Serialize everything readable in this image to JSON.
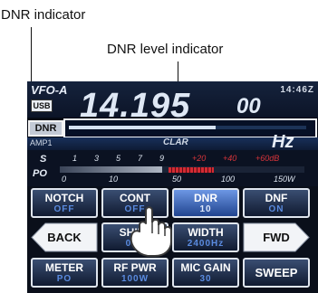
{
  "callouts": {
    "dnr_indicator": "DNR indicator",
    "dnr_level_indicator": "DNR level indicator"
  },
  "display": {
    "vfo": "VFO-A",
    "mode": "USB",
    "frequency_main": "14.195",
    "frequency_fraction": "00",
    "clock": "14:46Z",
    "dnr_badge": "DNR",
    "dnr_level": 0.62,
    "amp": "AMP1",
    "clar": "CLAR",
    "unit": "Hz"
  },
  "meter": {
    "s_label": "S",
    "po_label": "PO",
    "s_ticks": [
      "1",
      "3",
      "5",
      "7",
      "9",
      "+20",
      "+40",
      "+60dB"
    ],
    "po_ticks": [
      "0",
      "10",
      "50",
      "100",
      "150W"
    ],
    "level": 0.42
  },
  "buttons": {
    "notch": {
      "label": "NOTCH",
      "value": "OFF"
    },
    "cont": {
      "label": "CONT",
      "value": "OFF"
    },
    "dnr": {
      "label": "DNR",
      "value": "10"
    },
    "dnf": {
      "label": "DNF",
      "value": "ON"
    },
    "back": {
      "label": "BACK"
    },
    "shift": {
      "label": "SHIFT",
      "value": "0Hz"
    },
    "width": {
      "label": "WIDTH",
      "value": "2400Hz"
    },
    "fwd": {
      "label": "FWD"
    },
    "meter": {
      "label": "METER",
      "value": "PO"
    },
    "rf_pwr": {
      "label": "RF PWR",
      "value": "100W"
    },
    "mic_gain": {
      "label": "MIC GAIN",
      "value": "30"
    },
    "sweep": {
      "label": "SWEEP"
    }
  },
  "colors": {
    "accent": "#5a8be0",
    "selected": "#3e6bc4",
    "peak": "#d32a33"
  },
  "icons": {
    "pointer": "hand-pointer-icon"
  }
}
